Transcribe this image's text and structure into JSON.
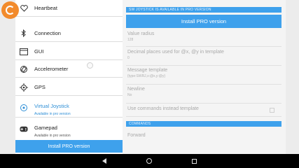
{
  "sidebar": {
    "items": [
      {
        "label": "Heartbeat",
        "icon": "heart-icon"
      },
      {
        "label": "Connection",
        "icon": "bluetooth-icon"
      },
      {
        "label": "GUI",
        "icon": "window-icon"
      },
      {
        "label": "Accelerometer",
        "icon": "rotate-icon"
      },
      {
        "label": "GPS",
        "icon": "crosshair-icon"
      },
      {
        "label": "Virtual Joystick",
        "sub": "Available in pro version",
        "icon": "joystick-target-icon"
      },
      {
        "label": "Gamepad",
        "sub": "Available in pro version",
        "icon": "gamepad-icon"
      }
    ],
    "install_label": "Install PRO version"
  },
  "main": {
    "banner": "SW JOYSTICK IS AVAILABLE IN PRO VERSION",
    "pro_button": "Install PRO version",
    "fields": [
      {
        "title": "Value radius",
        "value": "128"
      },
      {
        "title": "Decimal places used for @x, @y in template",
        "value": "0"
      },
      {
        "title": "Message template",
        "value": "{type:SWRJ,x:@x,y:@y}"
      },
      {
        "title": "Newline",
        "value": "No"
      },
      {
        "title": "Use commands instead template",
        "value": ""
      }
    ],
    "commands_header": "COMMANDS",
    "forward": "Forward"
  },
  "colors": {
    "accent": "#3ea1ec",
    "logo": "#f28b2c"
  }
}
